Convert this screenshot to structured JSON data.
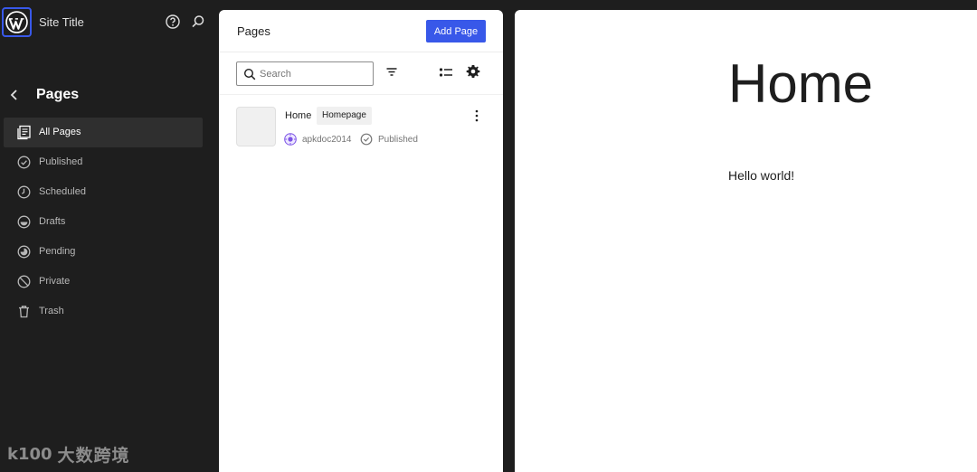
{
  "site": {
    "title": "Site Title"
  },
  "sidebar": {
    "section_title": "Pages",
    "items": [
      {
        "label": "All Pages",
        "icon": "pages-icon",
        "active": true
      },
      {
        "label": "Published",
        "icon": "published-icon",
        "active": false
      },
      {
        "label": "Scheduled",
        "icon": "scheduled-icon",
        "active": false
      },
      {
        "label": "Drafts",
        "icon": "drafts-icon",
        "active": false
      },
      {
        "label": "Pending",
        "icon": "pending-icon",
        "active": false
      },
      {
        "label": "Private",
        "icon": "private-icon",
        "active": false
      },
      {
        "label": "Trash",
        "icon": "trash-icon",
        "active": false
      }
    ]
  },
  "watermark": {
    "logo": "k100",
    "text": "大数跨境"
  },
  "panel": {
    "title": "Pages",
    "add_label": "Add Page",
    "search_placeholder": "Search",
    "rows": [
      {
        "title": "Home",
        "badge": "Homepage",
        "author": "apkdoc2014",
        "status": "Published"
      }
    ]
  },
  "preview": {
    "title": "Home",
    "body": "Hello world!"
  },
  "colors": {
    "accent": "#3858e9",
    "sidebar_bg": "#1e1e1e"
  }
}
